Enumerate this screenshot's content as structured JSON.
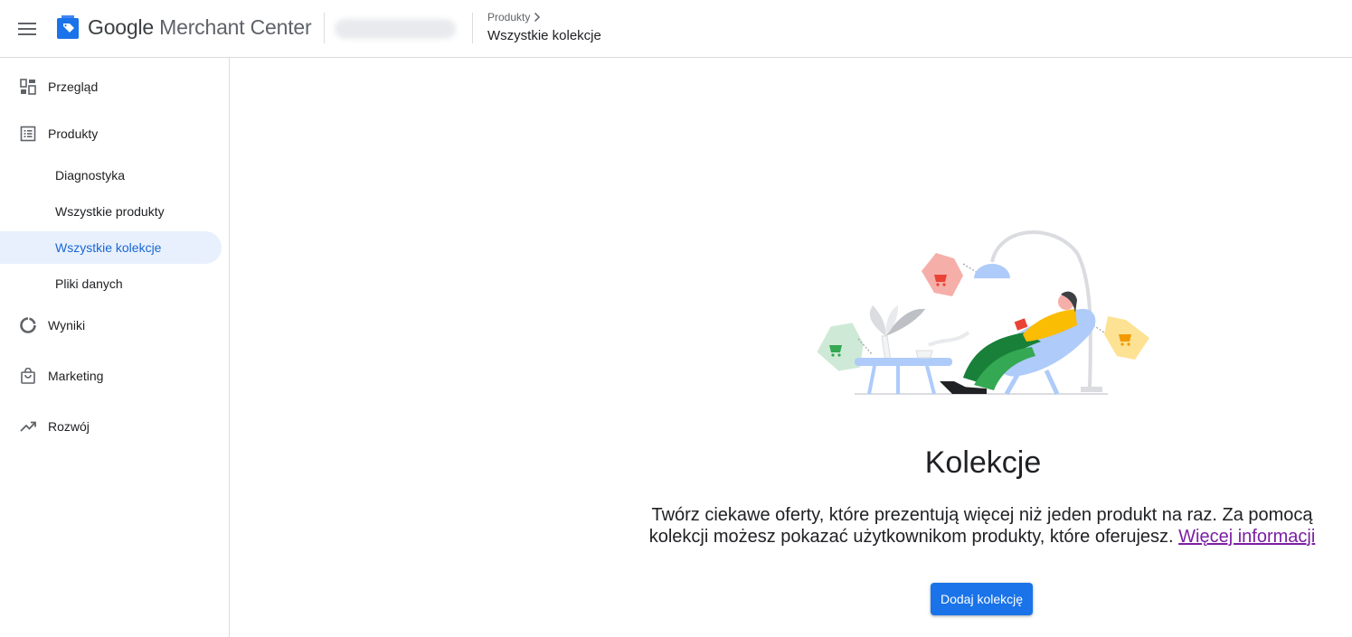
{
  "header": {
    "app_name_google": "Google",
    "app_name_rest": "Merchant Center",
    "breadcrumb_parent": "Produkty",
    "breadcrumb_current": "Wszystkie kolekcje"
  },
  "sidebar": {
    "items": [
      {
        "label": "Przegląd",
        "icon": "dashboard-icon"
      },
      {
        "label": "Produkty",
        "icon": "list-icon"
      },
      {
        "label": "Diagnostyka"
      },
      {
        "label": "Wszystkie produkty"
      },
      {
        "label": "Wszystkie kolekcje",
        "active": true
      },
      {
        "label": "Pliki danych"
      },
      {
        "label": "Wyniki",
        "icon": "donut-chart-icon"
      },
      {
        "label": "Marketing",
        "icon": "shopping-bag-icon"
      },
      {
        "label": "Rozwój",
        "icon": "trending-up-icon"
      }
    ]
  },
  "main": {
    "title": "Kolekcje",
    "description": "Twórz ciekawe oferty, które prezentują więcej niż jeden produkt na raz. Za pomocą kolekcji możesz pokazać użytkownikom produkty, które oferujesz.",
    "learn_more": "Więcej informacji",
    "add_button": "Dodaj kolekcję"
  },
  "colors": {
    "accent": "#1a73e8",
    "active_bg": "#e8f0fe",
    "active_text": "#1967d2",
    "link": "#7b1fa2"
  }
}
